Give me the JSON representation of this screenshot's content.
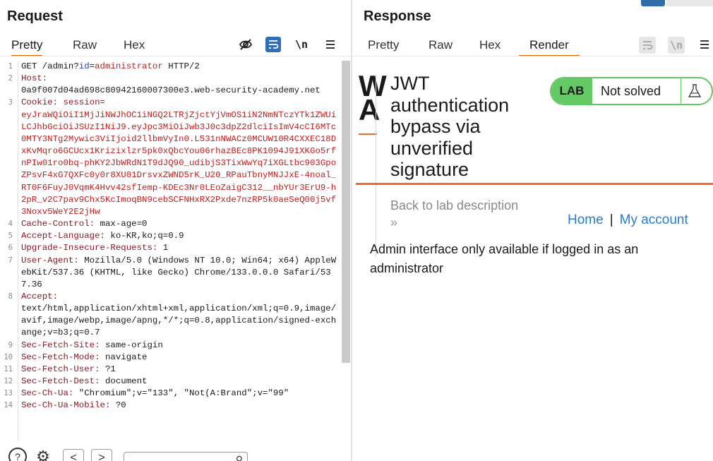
{
  "request": {
    "title": "Request",
    "tabs": [
      "Pretty",
      "Raw",
      "Hex"
    ],
    "toolbar": {
      "hide_icon": "eye-slash-icon",
      "wrap_icon": "wrap-lines-icon",
      "newline_label": "\\n",
      "menu_icon": "menu-icon"
    },
    "lines": [
      {
        "n": "1",
        "method": "GET /admin?",
        "param": "id",
        "eq": "=",
        "value": "administrator",
        "rest": " HTTP/2"
      },
      {
        "n": "2",
        "name": "Host:",
        "value": "0a9f007d04ad698c80942160007300e3.web-security-academy.net"
      },
      {
        "n": "3",
        "name": "Cookie: session=",
        "value": "eyJraWQiOiI1MjJiNWJhOC1iNGQ2LTRjZjctYjVmOS1iN2NmNTczYTk1ZWUiLCJhbGciOiJSUzI1NiJ9.eyJpc3MiOiJwb3J0c3dpZ2dlciIsImV4cCI6MTc0MTY3NTg2Mywic3ViIjoid2llbmVyIn0.L531nNWACz0MCUW10R4CXXEC18DxKvMqro6GCUcx1Krizixlzr5pk0xQbcYou06rhazBEc8PK1094J91XKGo5rfnPIw01ro0bq-phKY2JbWRdN1T9dJQ90_udibjS3TixWwYq7iXGLtbc903GpoZPsvF4xG7QXFc0y0r8XU01DrsvxZWND5rK_U20_RPauTbnyMNJJxE-4noal_RT0F6FuyJ0VqmK4Hvv42sfIemp-KDEc3Nr0LEoZaigC312__nbYUr3ErU9-h2pR_v2C7pav9Chx5KcImoqBN9cebSCFNHxRX2Pxde7nzRP5k0aeSeQ00j5vf3Noxv5WeY2E2jHw"
      },
      {
        "n": "4",
        "name": "Cache-Control:",
        "value": " max-age=0"
      },
      {
        "n": "5",
        "name": "Accept-Language:",
        "value": " ko-KR,ko;q=0.9"
      },
      {
        "n": "6",
        "name": "Upgrade-Insecure-Requests:",
        "value": " 1"
      },
      {
        "n": "7",
        "name": "User-Agent:",
        "value": " Mozilla/5.0 (Windows NT 10.0; Win64; x64) AppleWebKit/537.36 (KHTML, like Gecko) Chrome/133.0.0.0 Safari/537.36"
      },
      {
        "n": "8",
        "name": "Accept:",
        "value": "text/html,application/xhtml+xml,application/xml;q=0.9,image/avif,image/webp,image/apng,*/*;q=0.8,application/signed-exchange;v=b3;q=0.7"
      },
      {
        "n": "9",
        "name": "Sec-Fetch-Site:",
        "value": " same-origin"
      },
      {
        "n": "10",
        "name": "Sec-Fetch-Mode:",
        "value": " navigate"
      },
      {
        "n": "11",
        "name": "Sec-Fetch-User:",
        "value": " ?1"
      },
      {
        "n": "12",
        "name": "Sec-Fetch-Dest:",
        "value": " document"
      },
      {
        "n": "13",
        "name": "Sec-Ch-Ua:",
        "value": " \"Chromium\";v=\"133\", \"Not(A:Brand\";v=\"99\""
      },
      {
        "n": "14",
        "name": "Sec-Ch-Ua-Mobile:",
        "value": " ?0"
      }
    ],
    "bottom_bar": {
      "help_icon": "help-icon",
      "settings_icon": "gear-icon",
      "prev_label": "<",
      "next_label": ">",
      "search_icon": "search-icon"
    }
  },
  "response": {
    "title": "Response",
    "tabs": [
      "Pretty",
      "Raw",
      "Hex",
      "Render"
    ],
    "toolbar": {
      "wrap_icon": "wrap-lines-icon",
      "newline_label": "\\n",
      "menu_icon": "menu-icon"
    },
    "render": {
      "logo_fragment": "W\nA",
      "lab_title": "JWT authentication bypass via unverified signature",
      "lab_label": "LAB",
      "lab_status": "Not solved",
      "back_link": "Back to lab description",
      "back_chevron": "»",
      "nav_home": "Home",
      "nav_separator": "|",
      "nav_account": "My account",
      "message": "Admin interface only available if logged in as an administrator"
    }
  },
  "colors": {
    "accent_blue": "#2f6fb8",
    "tab_underline": "#e8630a",
    "lab_green": "#64c864",
    "portswigger_orange": "#f06a2b",
    "link_blue": "#2a7bc9",
    "header_name": "#8a1a28",
    "cookie_value": "#c0201f"
  }
}
